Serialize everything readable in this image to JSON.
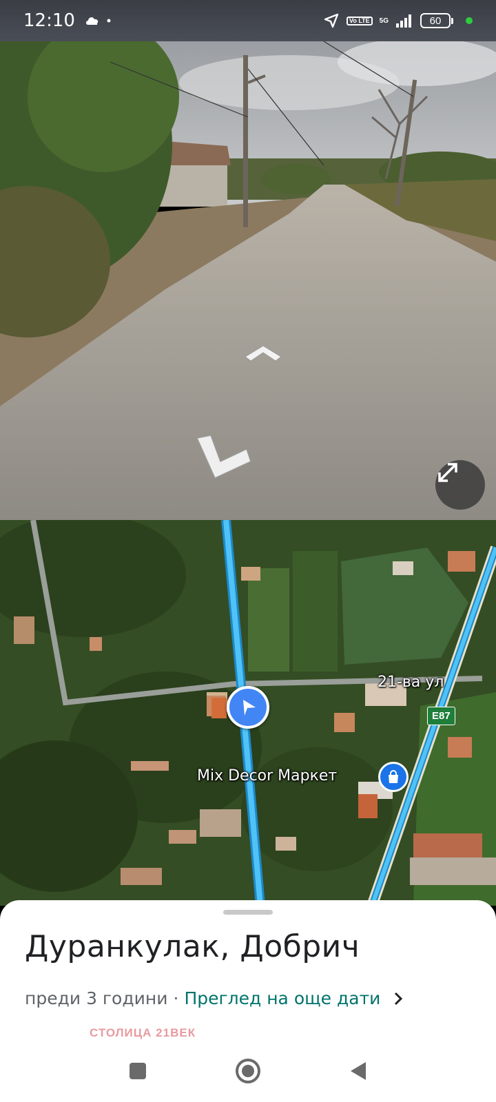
{
  "status_bar": {
    "time": "12:10",
    "volte": "Vo LTE",
    "network": "5G",
    "battery": "60",
    "icons": [
      "cloud-icon",
      "dot-icon",
      "location-arrow-icon",
      "signal-icon",
      "battery-icon"
    ]
  },
  "street_view": {
    "icons": [
      "forward-arrow-icon",
      "back-arrow-icon",
      "expand-icon"
    ]
  },
  "map": {
    "street_label": "21-ва ул",
    "road_badge": "E87",
    "poi_label": "Mix Decor Маркет",
    "icons": [
      "shopping-bag-icon",
      "navigation-arrow-icon"
    ]
  },
  "sheet": {
    "title": "Дуранкулак, Добрич",
    "age": "преди 3 години",
    "separator": "·",
    "more_dates": "Преглед на още дати",
    "watermark": "СТОЛИЦА 21ВЕК"
  },
  "colors": {
    "link": "#00736c",
    "route": "#29b6f6",
    "marker": "#4285f4"
  }
}
